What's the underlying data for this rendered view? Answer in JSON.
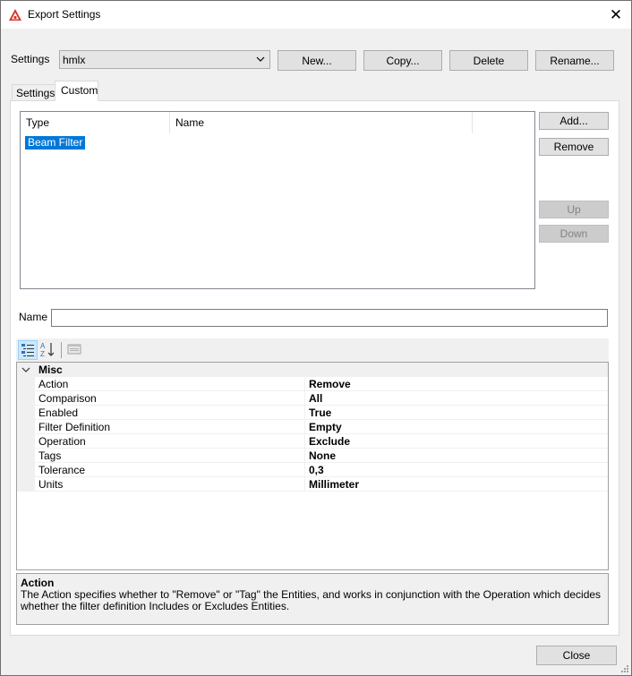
{
  "window": {
    "title": "Export Settings",
    "close_glyph": "✕"
  },
  "settings": {
    "label": "Settings",
    "selected": "hmlx",
    "buttons": {
      "new": "New...",
      "copy": "Copy...",
      "delete": "Delete",
      "rename": "Rename..."
    }
  },
  "tabs": [
    {
      "label": "Settings"
    },
    {
      "label": "Custom"
    }
  ],
  "list": {
    "columns": [
      "Type",
      "Name"
    ],
    "rows": [
      {
        "type": "Beam Filter",
        "name": ""
      }
    ]
  },
  "side_buttons": {
    "add": "Add...",
    "remove": "Remove",
    "up": "Up",
    "down": "Down"
  },
  "name_field": {
    "label": "Name",
    "value": ""
  },
  "property_grid": {
    "category": "Misc",
    "properties": [
      {
        "name": "Action",
        "value": "Remove"
      },
      {
        "name": "Comparison",
        "value": "All"
      },
      {
        "name": "Enabled",
        "value": "True"
      },
      {
        "name": "Filter Definition",
        "value": "Empty"
      },
      {
        "name": "Operation",
        "value": "Exclude"
      },
      {
        "name": "Tags",
        "value": "None"
      },
      {
        "name": "Tolerance",
        "value": "0,3"
      },
      {
        "name": "Units",
        "value": "Millimeter"
      }
    ]
  },
  "description": {
    "title": "Action",
    "text": "The Action specifies whether to \"Remove\" or \"Tag\" the Entities, and works in conjunction with the Operation which decides whether the filter definition Includes or Excludes Entities."
  },
  "footer": {
    "close": "Close"
  },
  "icons": {
    "app": "app-logo-icon",
    "categorized": "categorized-view-icon",
    "alphabetical": "alphabetical-sort-icon",
    "property_pages": "property-pages-icon",
    "collapse": "chevron-down-icon"
  },
  "colors": {
    "selection": "#0078d7",
    "app_icon": "#d9352b"
  }
}
